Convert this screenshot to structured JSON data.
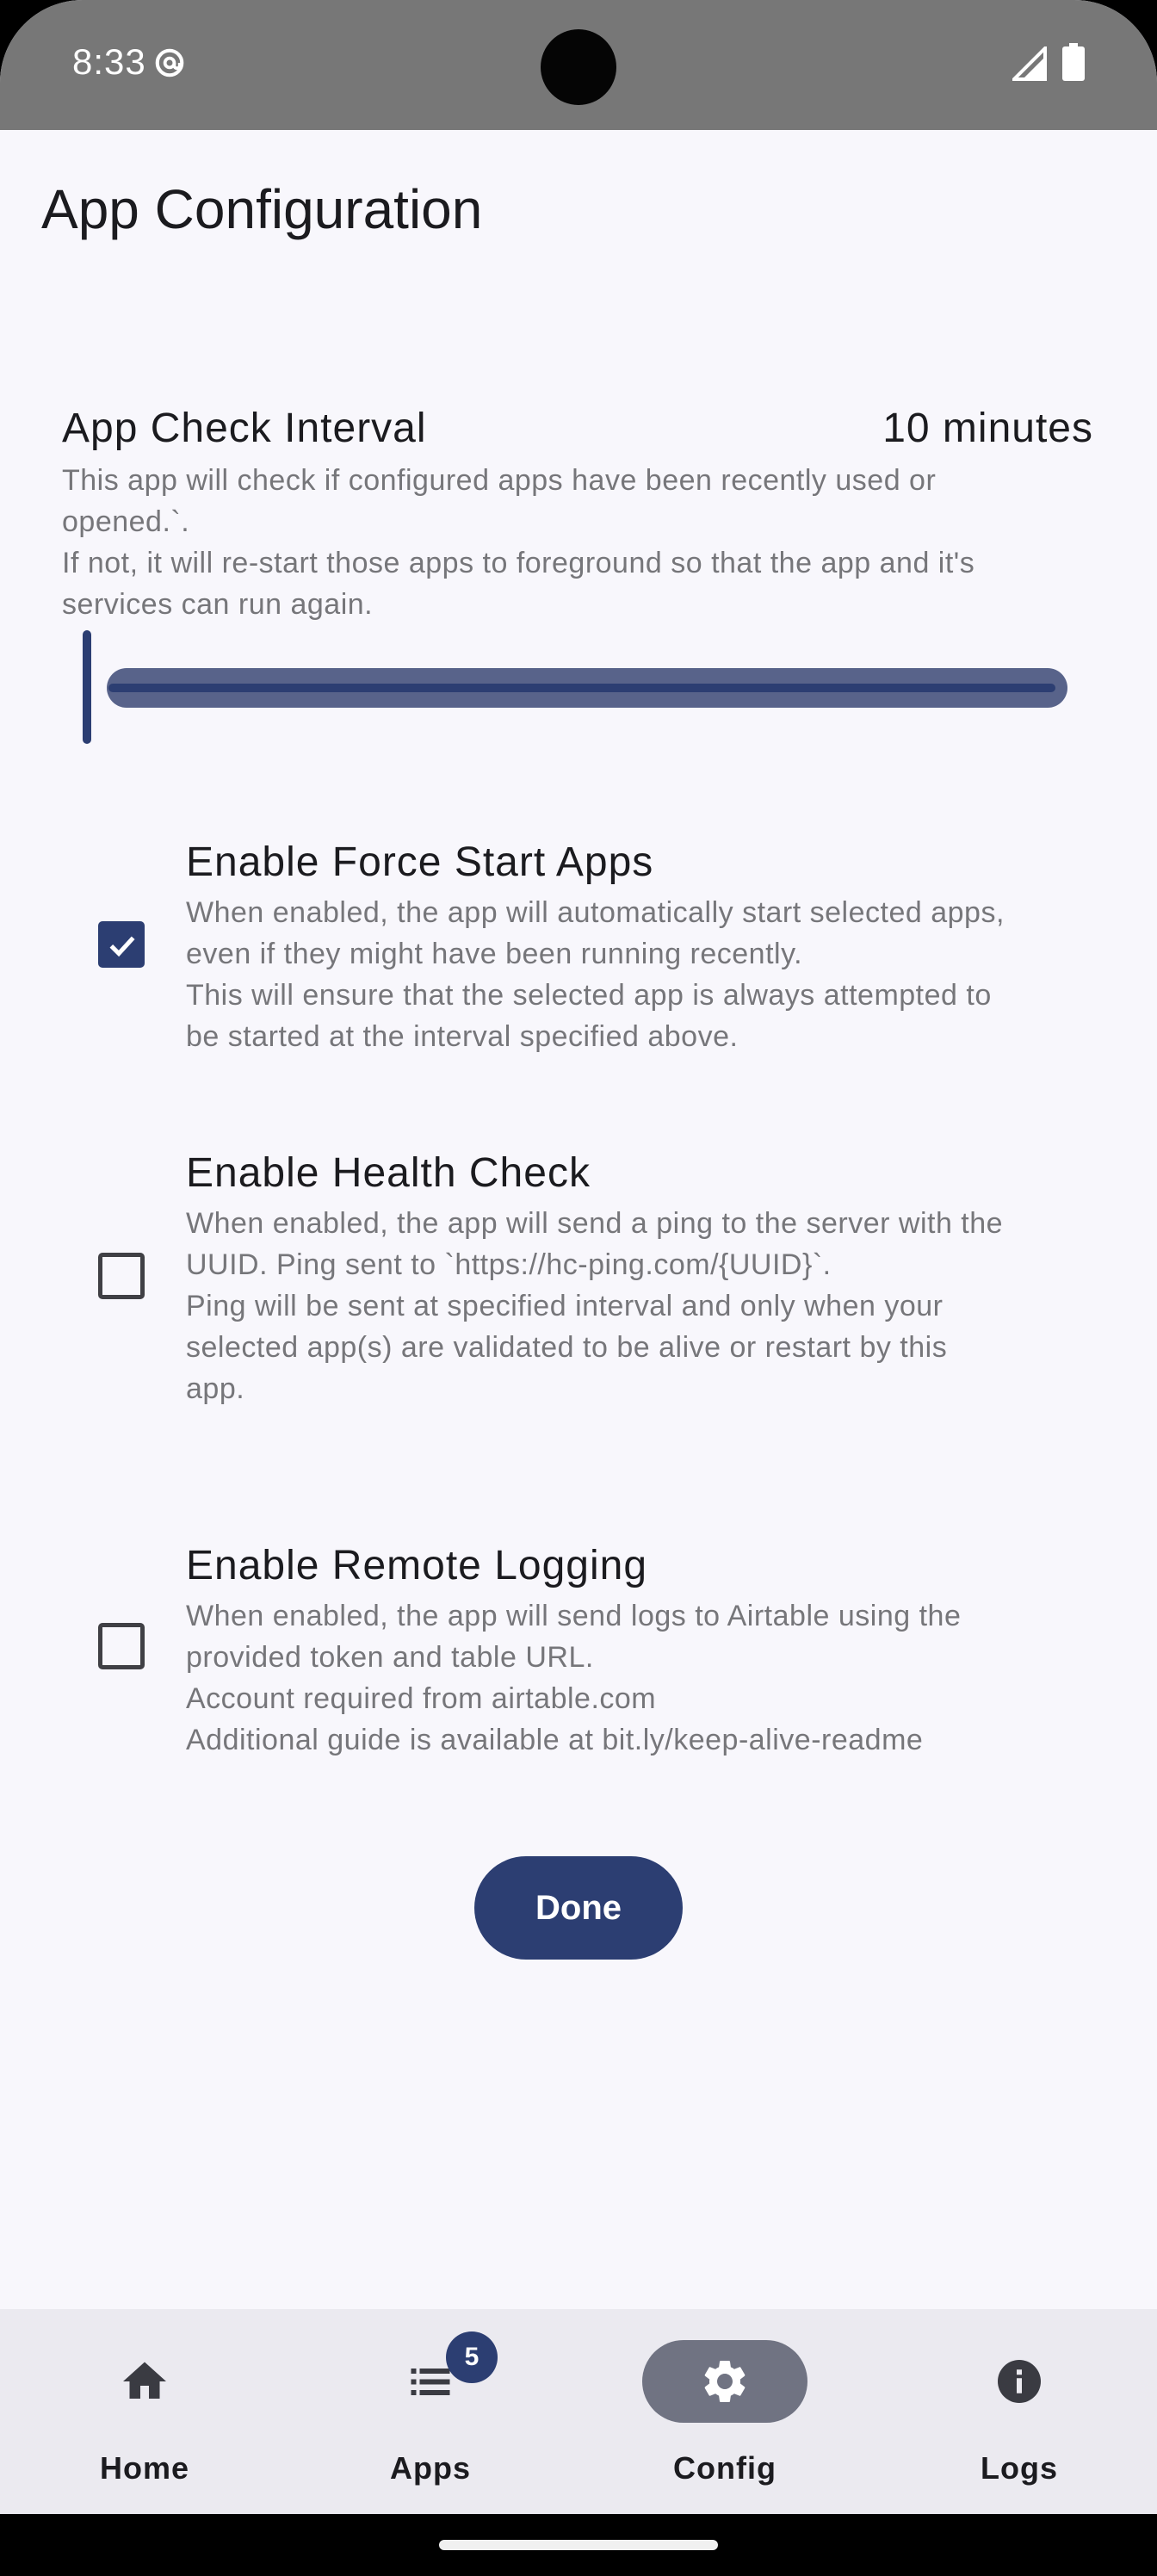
{
  "status_bar": {
    "time": "8:33"
  },
  "header": {
    "title": "App Configuration"
  },
  "interval": {
    "title": "App Check Interval",
    "value": "10 minutes",
    "description_lines": [
      "This app will check if configured apps have been recently used or",
      "opened.`.",
      "If not, it will re-start those apps to foreground so that the app and it's",
      "services can run again."
    ],
    "slider_fraction": 0.0
  },
  "options": [
    {
      "title": "Enable Force Start Apps",
      "checked": true,
      "description_lines": [
        "When enabled, the app will automatically start selected apps,",
        "even if they might have been running recently.",
        "This will ensure that the selected app is always attempted to",
        "be started at the interval specified above."
      ]
    },
    {
      "title": "Enable Health Check",
      "checked": false,
      "description_lines": [
        "When enabled, the app will send a ping to the server with the",
        "UUID. Ping sent to `https://hc-ping.com/{UUID}`.",
        "Ping will be sent at specified interval and only when your",
        "selected app(s) are validated to be alive or restart by this",
        "app."
      ]
    },
    {
      "title": "Enable Remote Logging",
      "checked": false,
      "description_lines": [
        "When enabled, the app will send logs to Airtable using the",
        "provided token and table URL.",
        "Account required from airtable.com",
        "Additional guide is available at bit.ly/keep-alive-readme"
      ]
    }
  ],
  "done_button": {
    "label": "Done"
  },
  "nav": {
    "items": [
      {
        "label": "Home",
        "icon": "home-icon"
      },
      {
        "label": "Apps",
        "icon": "list-icon",
        "badge": "5"
      },
      {
        "label": "Config",
        "icon": "gear-icon",
        "active": true
      },
      {
        "label": "Logs",
        "icon": "info-icon"
      }
    ]
  },
  "colors": {
    "accent": "#2c3e72",
    "status_bar": "#777777",
    "background": "#f8f7fc",
    "nav_background": "#ebeaf0"
  }
}
